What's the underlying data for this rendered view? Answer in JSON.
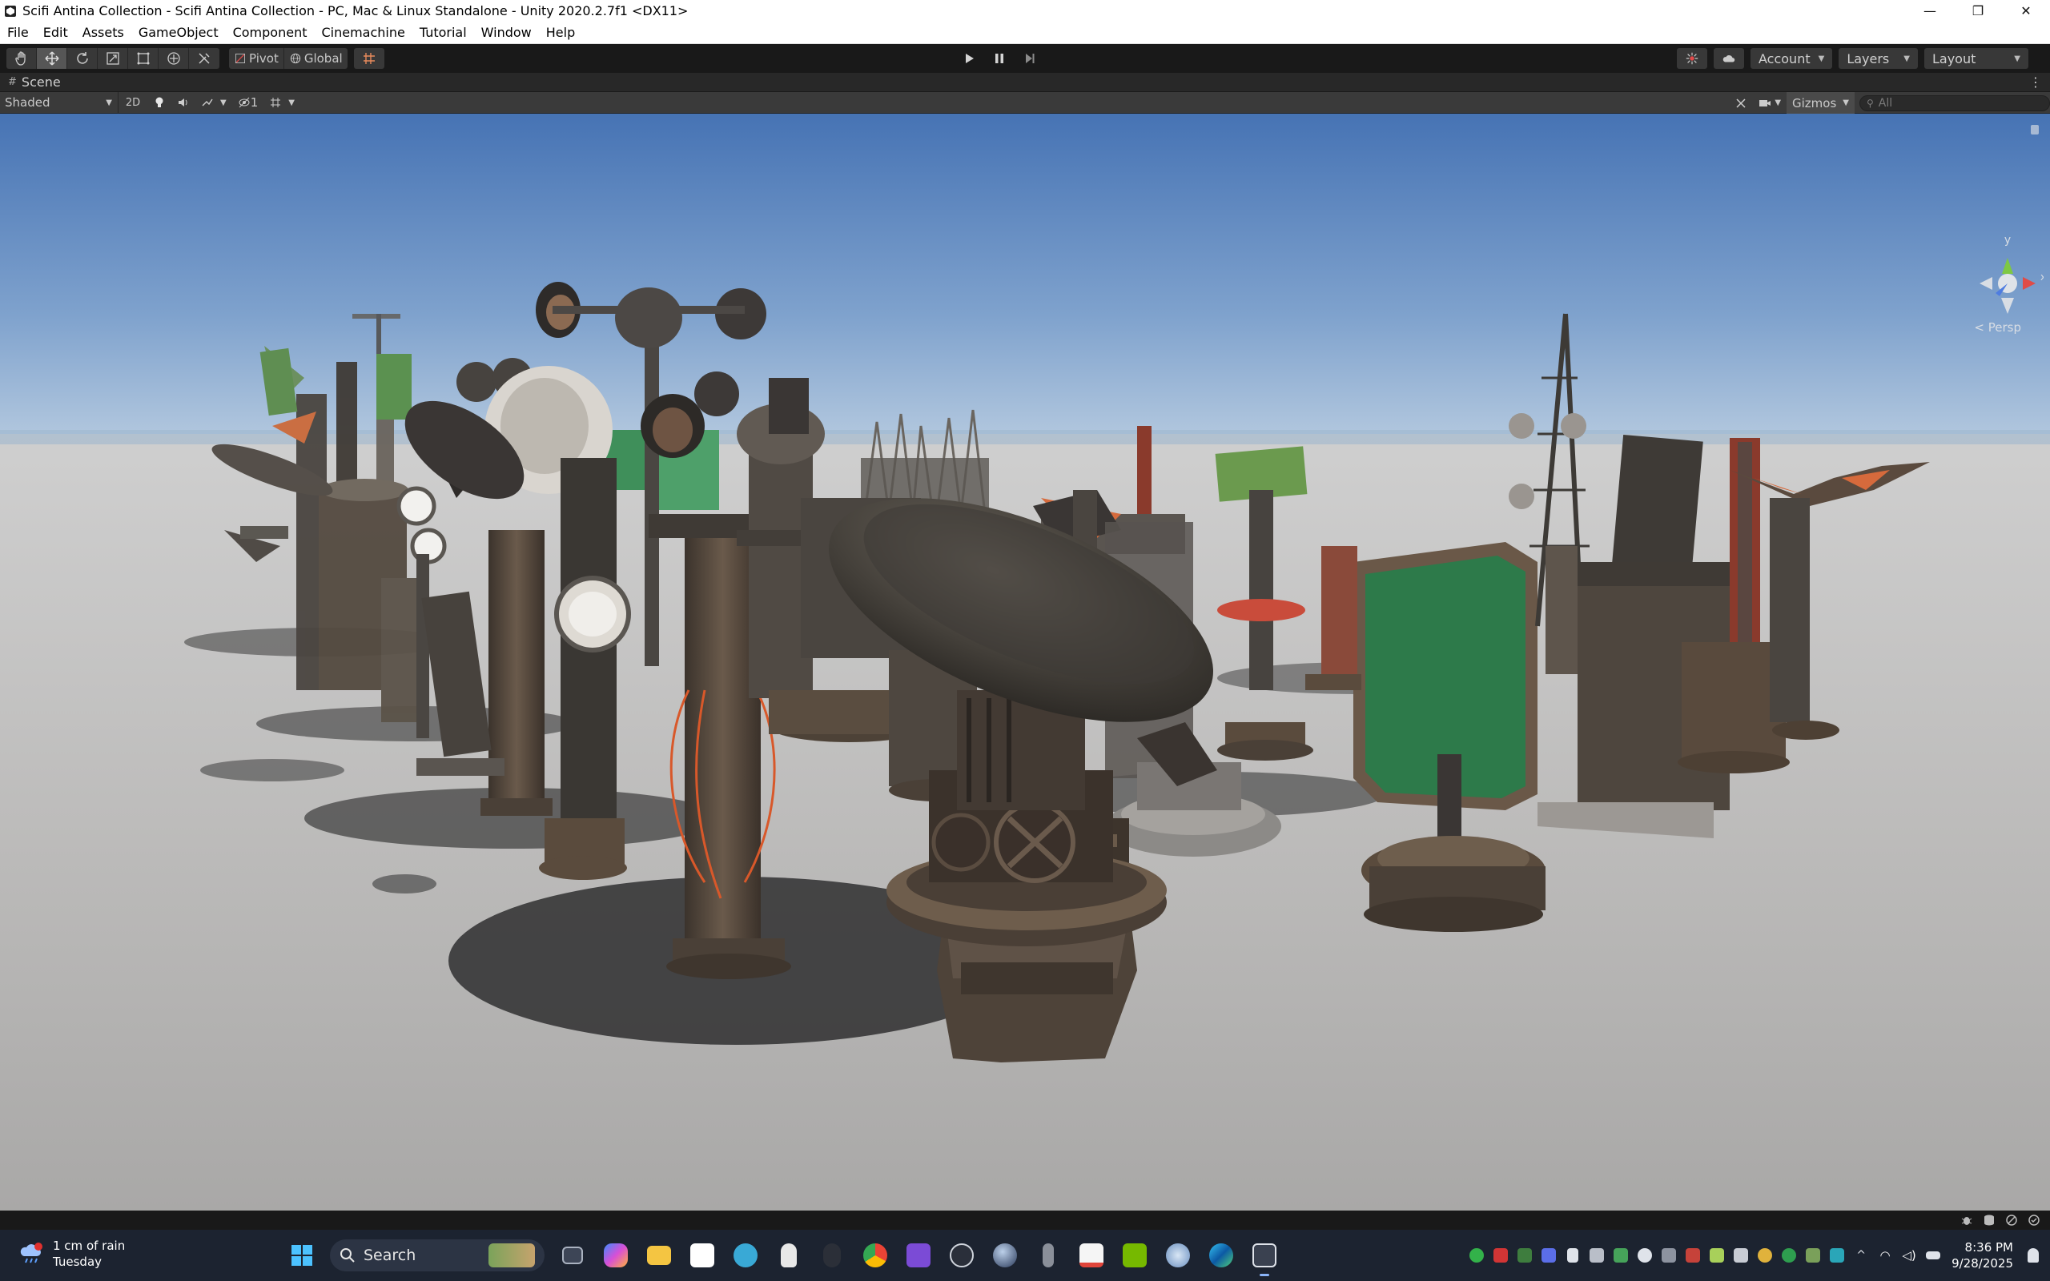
{
  "window": {
    "title": "Scifi Antina Collection - Scifi Antina Collection - PC, Mac & Linux Standalone - Unity 2020.2.7f1 <DX11>",
    "minimize": "—",
    "maximize": "❐",
    "close": "✕"
  },
  "menu": [
    "File",
    "Edit",
    "Assets",
    "GameObject",
    "Component",
    "Cinemachine",
    "Tutorial",
    "Window",
    "Help"
  ],
  "toolbar": {
    "pivot_label": "Pivot",
    "global_label": "Global",
    "account_label": "Account",
    "layers_label": "Layers",
    "layout_label": "Layout"
  },
  "scene_tab": {
    "label": "Scene",
    "more": "⋮"
  },
  "scene_toolbar": {
    "shading_mode": "Shaded",
    "two_d_label": "2D",
    "hidden_count": "1",
    "gizmos_label": "Gizmos",
    "search_placeholder": "All"
  },
  "viewport": {
    "projection_label": "< Persp",
    "axis_label_y": "y",
    "axis_label_x": "x"
  },
  "taskbar": {
    "weather_line1": "1 cm of rain",
    "weather_line2": "Tuesday",
    "search_label": "Search",
    "time": "8:36 PM",
    "date": "9/28/2025"
  },
  "colors": {
    "titlebar_bg": "#ffffff",
    "toolbar_bg": "#191919",
    "scene_bar_bg": "#3a3a3a",
    "sky_top": "#4a78b8",
    "ground": "#bdbcbb",
    "taskbar_bg": "#1c2330"
  }
}
